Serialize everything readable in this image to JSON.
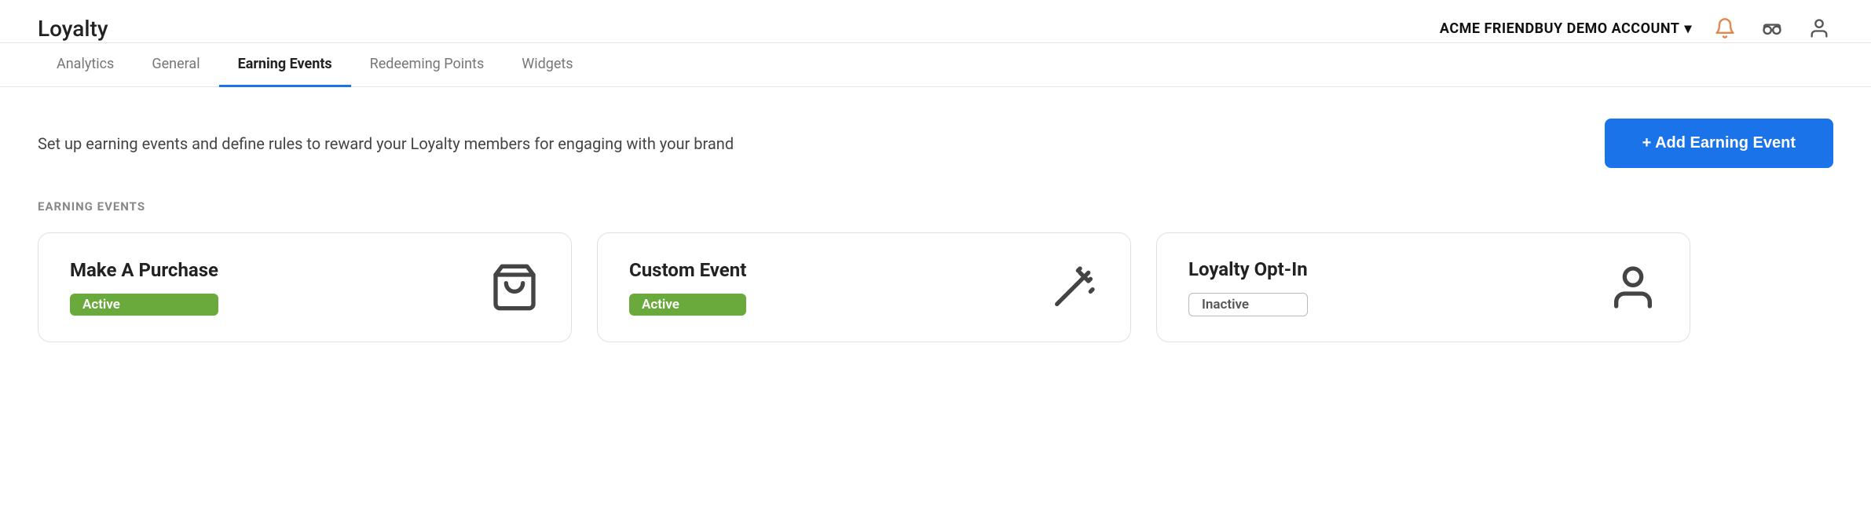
{
  "app": {
    "title": "Loyalty"
  },
  "header": {
    "account_name": "ACME FRIENDBUY DEMO ACCOUNT",
    "chevron": "▾"
  },
  "nav": {
    "tabs": [
      {
        "label": "Analytics",
        "active": false
      },
      {
        "label": "General",
        "active": false
      },
      {
        "label": "Earning Events",
        "active": true
      },
      {
        "label": "Redeeming Points",
        "active": false
      },
      {
        "label": "Widgets",
        "active": false
      }
    ]
  },
  "main": {
    "description": "Set up earning events and define rules to reward your Loyalty members for engaging with your brand",
    "add_button_label": "+ Add Earning Event",
    "section_label": "EARNING EVENTS",
    "cards": [
      {
        "title": "Make A Purchase",
        "status": "Active",
        "status_type": "active",
        "icon": "shopping-bag"
      },
      {
        "title": "Custom Event",
        "status": "Active",
        "status_type": "active",
        "icon": "magic-wand"
      },
      {
        "title": "Loyalty Opt-In",
        "status": "Inactive",
        "status_type": "inactive",
        "icon": "person"
      }
    ]
  }
}
